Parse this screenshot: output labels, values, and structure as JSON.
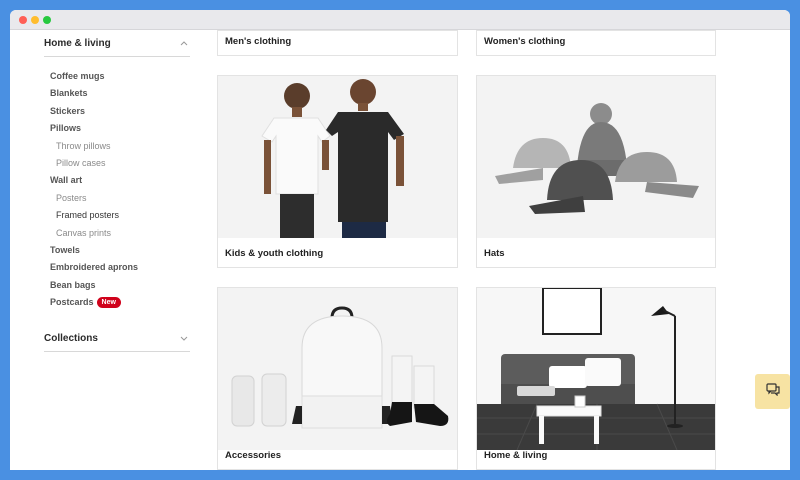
{
  "sidebar": {
    "home_living": {
      "title": "Home & living",
      "items": [
        {
          "label": "Coffee mugs"
        },
        {
          "label": "Blankets"
        },
        {
          "label": "Stickers"
        },
        {
          "label": "Pillows"
        },
        {
          "label": "Throw pillows"
        },
        {
          "label": "Pillow cases"
        },
        {
          "label": "Wall art"
        },
        {
          "label": "Posters"
        },
        {
          "label": "Framed posters"
        },
        {
          "label": "Canvas prints"
        },
        {
          "label": "Towels"
        },
        {
          "label": "Embroidered aprons"
        },
        {
          "label": "Bean bags"
        },
        {
          "label": "Postcards",
          "badge": "New"
        }
      ]
    },
    "collections": {
      "title": "Collections"
    }
  },
  "cards": [
    {
      "label": "Men's clothing"
    },
    {
      "label": "Women's clothing"
    },
    {
      "label": "Kids & youth clothing"
    },
    {
      "label": "Hats"
    },
    {
      "label": "Accessories"
    },
    {
      "label": "Home & living"
    }
  ],
  "icons": {
    "chevron_up": "chevron-up-icon",
    "chevron_down": "chevron-down-icon",
    "chat": "chat-icon"
  },
  "colors": {
    "frame": "#4a90e2",
    "new_badge": "#d0021b",
    "chat_button": "#f7e3a3"
  }
}
